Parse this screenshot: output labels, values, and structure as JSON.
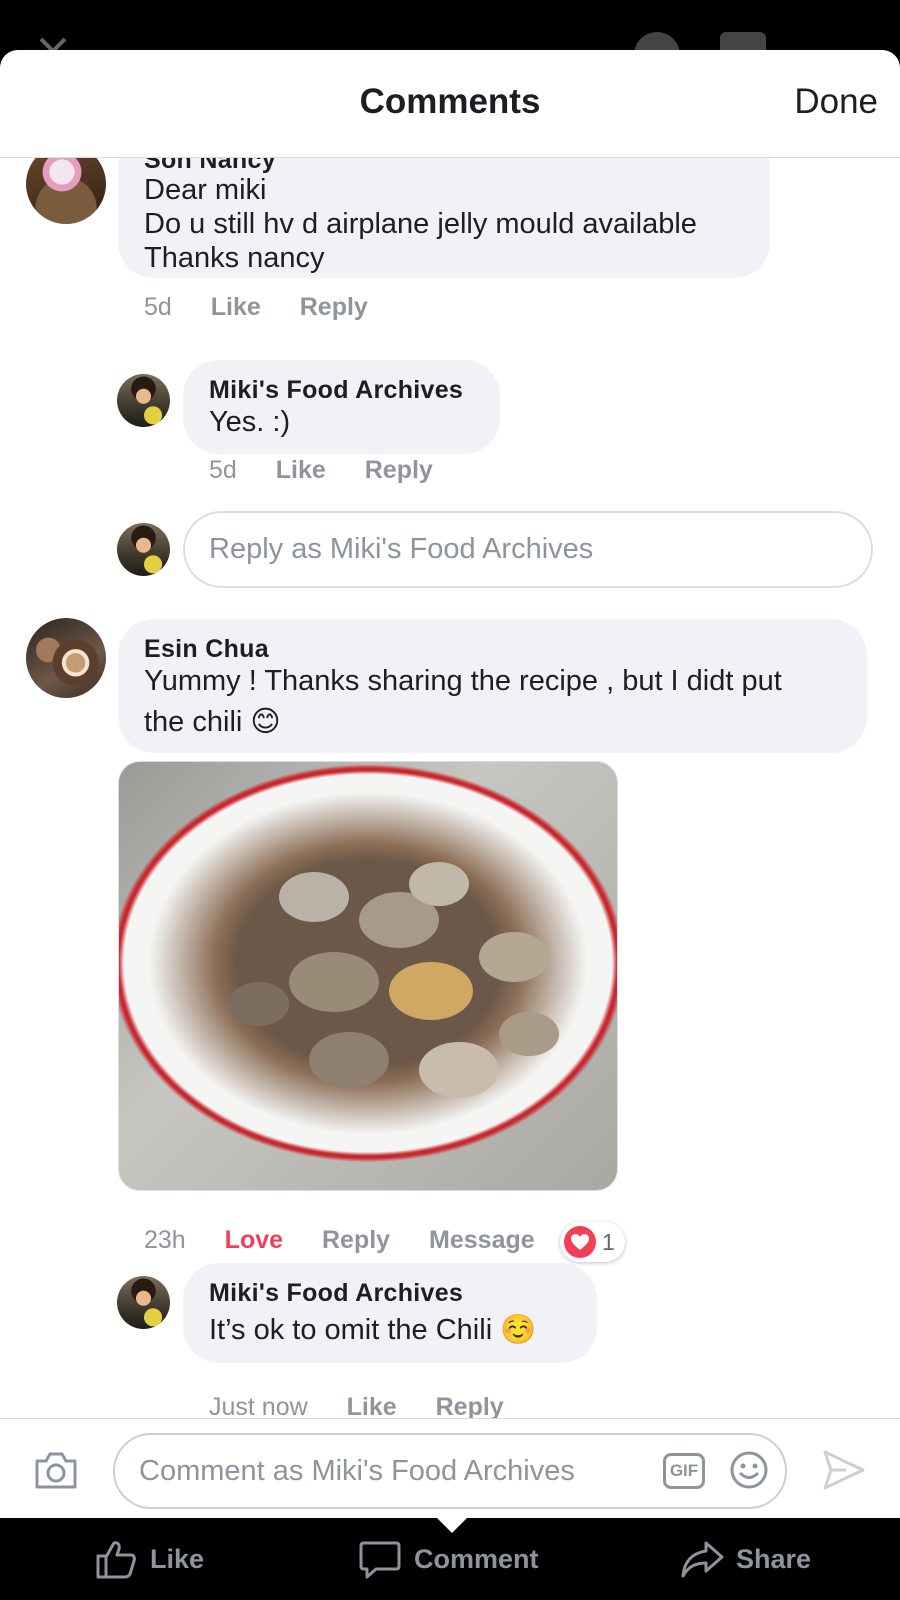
{
  "header": {
    "title": "Comments",
    "done_label": "Done"
  },
  "comments": [
    {
      "author": "Soh Nancy",
      "lines": [
        "Dear miki",
        "Do u still hv d airplane jelly mould available",
        "Thanks nancy"
      ],
      "time": "5d",
      "like": "Like",
      "reply": "Reply",
      "replies": [
        {
          "author": "Miki's Food Archives",
          "text": "Yes. :)",
          "time": "5d",
          "like": "Like",
          "reply": "Reply"
        }
      ],
      "reply_placeholder": "Reply as Miki's Food Archives"
    },
    {
      "author": "Esin Chua",
      "lines": [
        "Yummy ! Thanks sharing the recipe , but I didt put",
        "the chili 😊"
      ],
      "time": "23h",
      "like": "Love",
      "reply": "Reply",
      "message": "Message",
      "reaction_count": "1",
      "replies": [
        {
          "author": "Miki's Food Archives",
          "text": "It’s ok to omit the Chili ☺️",
          "time": "Just now",
          "like": "Like",
          "reply": "Reply"
        }
      ]
    }
  ],
  "composer": {
    "placeholder": "Comment as Miki's Food Archives",
    "gif_label": "GIF"
  },
  "actionbar": {
    "like": "Like",
    "comment": "Comment",
    "share": "Share"
  },
  "colors": {
    "love": "#f33e58",
    "muted": "#90949c",
    "bubble": "#f0f2f5"
  }
}
